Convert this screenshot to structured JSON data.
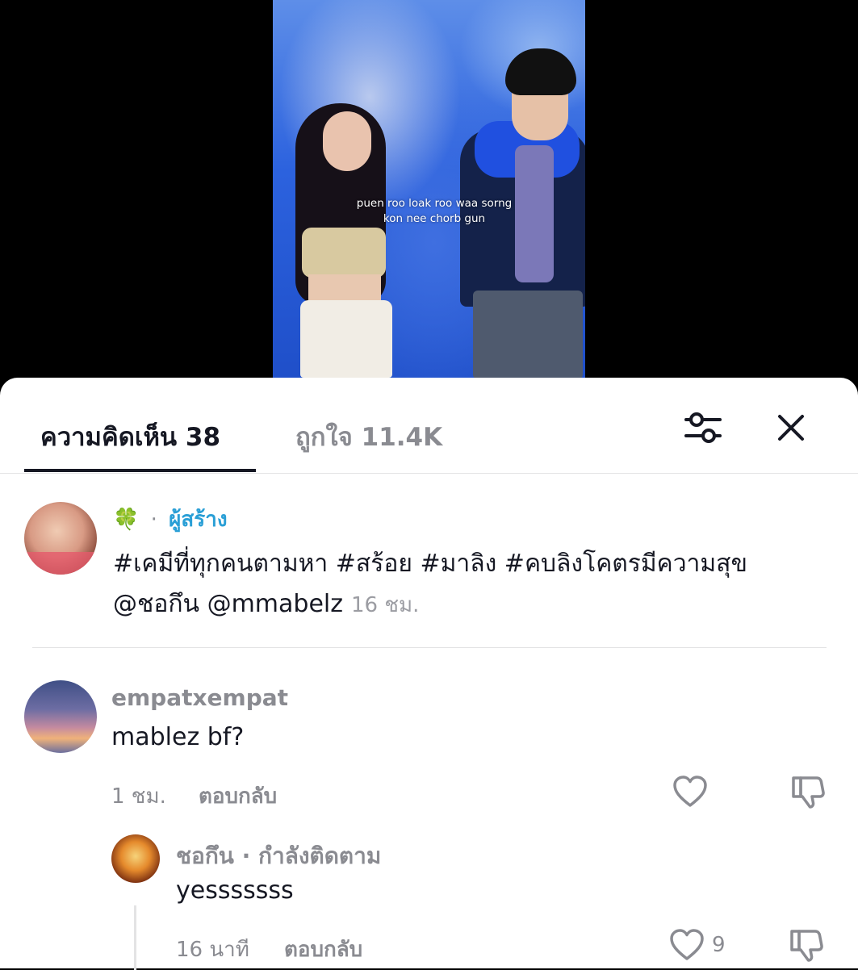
{
  "video": {
    "caption_line1": "puen roo loak roo waa sorng",
    "caption_line2": "kon nee chorb gun"
  },
  "tabs": {
    "comments_label": "ความคิดเห็น 38",
    "likes_label": "ถูกใจ 11.4K"
  },
  "creator_post": {
    "emoji": "🍀",
    "separator": "·",
    "badge": "ผู้สร้าง",
    "caption": "#เคมีที่ทุกคนตามหา #สร้อย #มาลิง #คบลิงโคตรมีความสุข @ชอกึน @mmabelz",
    "time": "16 ชม."
  },
  "comments": [
    {
      "username": "empatxempat",
      "text": "mablez bf?",
      "time": "1 ชม.",
      "reply_label": "ตอบกลับ"
    },
    {
      "username": "ชอกึน · กำลังติดตาม",
      "text": "yesssssss",
      "time": "16 นาที",
      "reply_label": "ตอบกลับ",
      "like_count": "9"
    }
  ],
  "colors": {
    "text_primary": "#161823",
    "text_secondary": "#8a8b91",
    "creator_badge": "#2a9fd6",
    "divider": "#e3e3e4"
  }
}
